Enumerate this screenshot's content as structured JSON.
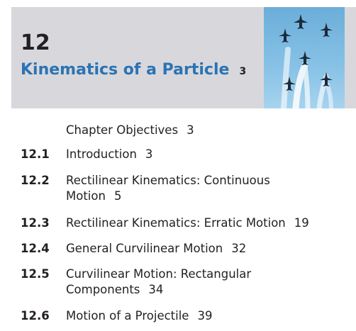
{
  "chapter": {
    "number": "12",
    "title": "Kinematics of a Particle",
    "page": "3"
  },
  "toc": [
    {
      "section": "",
      "title": "Chapter Objectives",
      "page": "3"
    },
    {
      "section": "12.1",
      "title": "Introduction",
      "page": "3"
    },
    {
      "section": "12.2",
      "title": "Rectilinear Kinematics: Continuous\nMotion",
      "page": "5"
    },
    {
      "section": "12.3",
      "title": "Rectilinear Kinematics: Erratic Motion",
      "page": "19"
    },
    {
      "section": "12.4",
      "title": "General Curvilinear Motion",
      "page": "32"
    },
    {
      "section": "12.5",
      "title": "Curvilinear Motion: Rectangular\nComponents",
      "page": "34"
    },
    {
      "section": "12.6",
      "title": "Motion of a Projectile",
      "page": "39"
    }
  ],
  "colors": {
    "accent": "#2b73b4",
    "header_bg": "#d8d8dc",
    "sky": "#88c2e6"
  },
  "image": {
    "subject": "jet aircraft formation with smoke trails"
  }
}
